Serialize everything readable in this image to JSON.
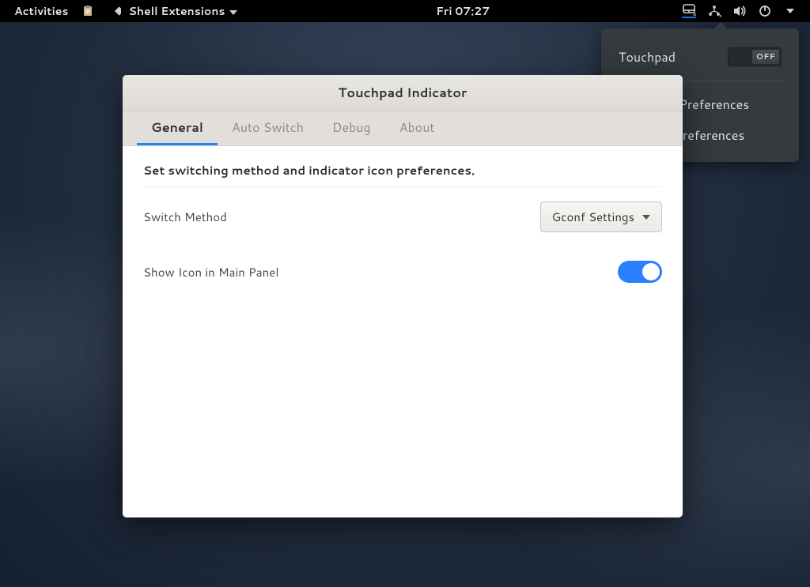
{
  "topbar": {
    "activities": "Activities",
    "app_menu": "Shell Extensions",
    "clock": "Fri 07:27"
  },
  "popover": {
    "title": "Touchpad",
    "toggle_state": "OFF",
    "items": [
      "Touchpad Preferences",
      "Indicator Preferences"
    ]
  },
  "dialog": {
    "title": "Touchpad Indicator",
    "tabs": [
      "General",
      "Auto Switch",
      "Debug",
      "About"
    ],
    "active_tab": 0,
    "section_desc": "Set switching method and indicator icon preferences.",
    "rows": {
      "switch_method": {
        "label": "Switch Method",
        "value": "Gconf Settings"
      },
      "show_icon": {
        "label": "Show Icon in Main Panel",
        "on": true
      }
    }
  }
}
